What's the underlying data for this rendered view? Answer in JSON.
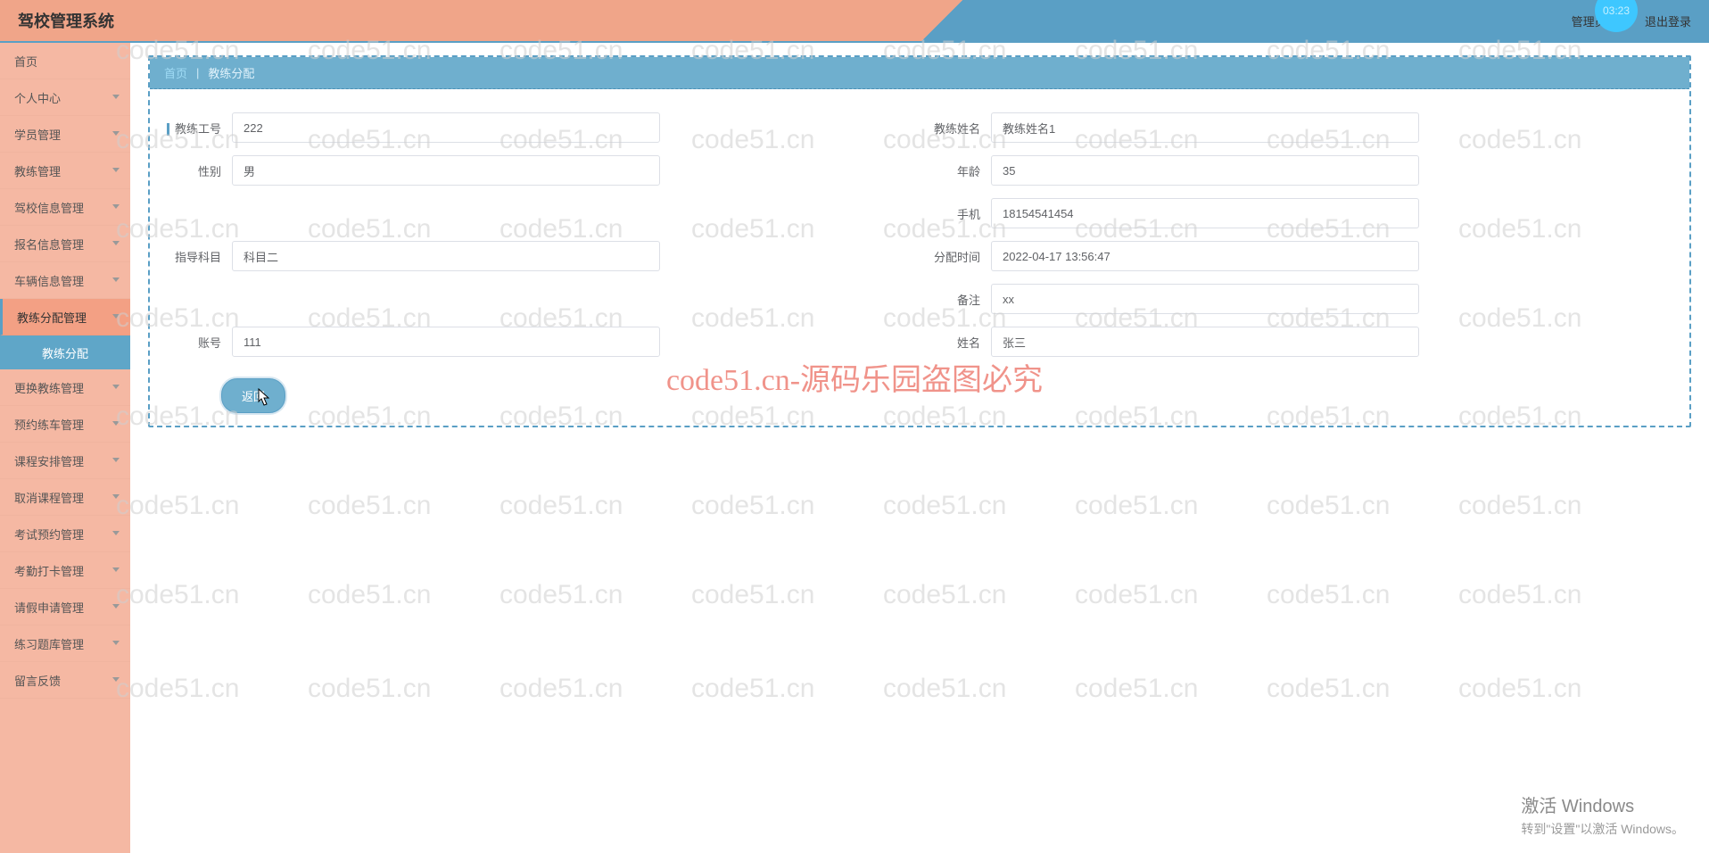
{
  "app": {
    "title": "驾校管理系统"
  },
  "header": {
    "clock": "03:23",
    "user_label": "管理员 abo",
    "logout": "退出登录"
  },
  "sidebar": {
    "items": [
      {
        "label": "首页",
        "expandable": false
      },
      {
        "label": "个人中心",
        "expandable": true
      },
      {
        "label": "学员管理",
        "expandable": true
      },
      {
        "label": "教练管理",
        "expandable": true
      },
      {
        "label": "驾校信息管理",
        "expandable": true
      },
      {
        "label": "报名信息管理",
        "expandable": true
      },
      {
        "label": "车辆信息管理",
        "expandable": true
      },
      {
        "label": "教练分配管理",
        "expandable": true,
        "active": true,
        "sub": [
          {
            "label": "教练分配"
          }
        ]
      },
      {
        "label": "更换教练管理",
        "expandable": true
      },
      {
        "label": "预约练车管理",
        "expandable": true
      },
      {
        "label": "课程安排管理",
        "expandable": true
      },
      {
        "label": "取消课程管理",
        "expandable": true
      },
      {
        "label": "考试预约管理",
        "expandable": true
      },
      {
        "label": "考勤打卡管理",
        "expandable": true
      },
      {
        "label": "请假申请管理",
        "expandable": true
      },
      {
        "label": "练习题库管理",
        "expandable": true
      },
      {
        "label": "留言反馈",
        "expandable": true
      }
    ]
  },
  "breadcrumb": {
    "home": "首页",
    "sep": "|",
    "current": "教练分配"
  },
  "form": {
    "left": [
      {
        "label": "教练工号",
        "value": "222",
        "marked": true
      },
      {
        "label": "性别",
        "value": "男"
      },
      {
        "blank": true
      },
      {
        "label": "指导科目",
        "value": "科目二"
      },
      {
        "blank": true
      },
      {
        "label": "账号",
        "value": "111"
      }
    ],
    "right": [
      {
        "label": "教练姓名",
        "value": "教练姓名1"
      },
      {
        "label": "年龄",
        "value": "35"
      },
      {
        "label": "手机",
        "value": "18154541454"
      },
      {
        "label": "分配时间",
        "value": "2022-04-17 13:56:47"
      },
      {
        "label": "备注",
        "value": "xx"
      },
      {
        "label": "姓名",
        "value": "张三"
      }
    ],
    "back_button": "返回"
  },
  "watermark": {
    "text": "code51.cn",
    "center": "code51.cn-源码乐园盗图必究"
  },
  "activate": {
    "title": "激活 Windows",
    "sub": "转到\"设置\"以激活 Windows。"
  }
}
